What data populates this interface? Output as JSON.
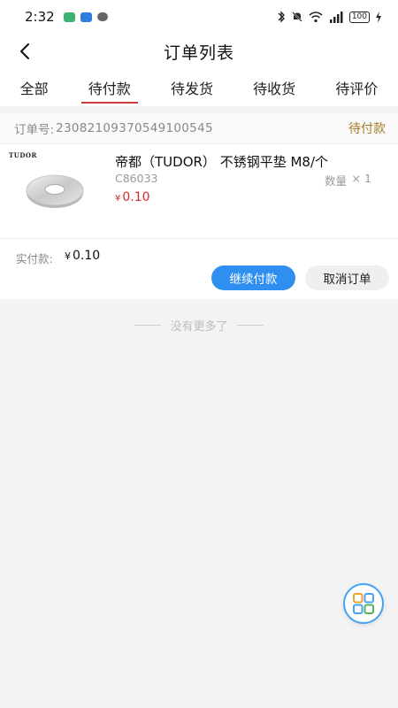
{
  "status_bar": {
    "time": "2:32",
    "battery": "100"
  },
  "header": {
    "title": "订单列表"
  },
  "tabs": [
    {
      "label": "全部",
      "active": false
    },
    {
      "label": "待付款",
      "active": true
    },
    {
      "label": "待发货",
      "active": false
    },
    {
      "label": "待收货",
      "active": false
    },
    {
      "label": "待评价",
      "active": false
    }
  ],
  "order": {
    "number_label": "订单号:",
    "number": "2308210937054910054​5",
    "status": "待付款",
    "product": {
      "brand_mark": "TUDOR",
      "name": "帝都（TUDOR） 不锈钢平垫 M8/个",
      "code": "C86033",
      "quantity_label": "数量",
      "quantity_x": "×",
      "quantity": "1",
      "currency": "¥",
      "price": "0.10"
    },
    "paid_label": "实付款:",
    "paid_currency": "¥",
    "paid_amount": "0.10",
    "pay_button": "继续付款",
    "cancel_button": "取消订单"
  },
  "list_end_text": "没有更多了",
  "colors": {
    "accent_red": "#d23c3c",
    "price_red": "#d42b2b",
    "status_gold": "#a57b2a",
    "primary_blue": "#2f8ff0"
  },
  "icons": {
    "back": "chevron-left-icon",
    "fab": "grid-menu-icon"
  }
}
